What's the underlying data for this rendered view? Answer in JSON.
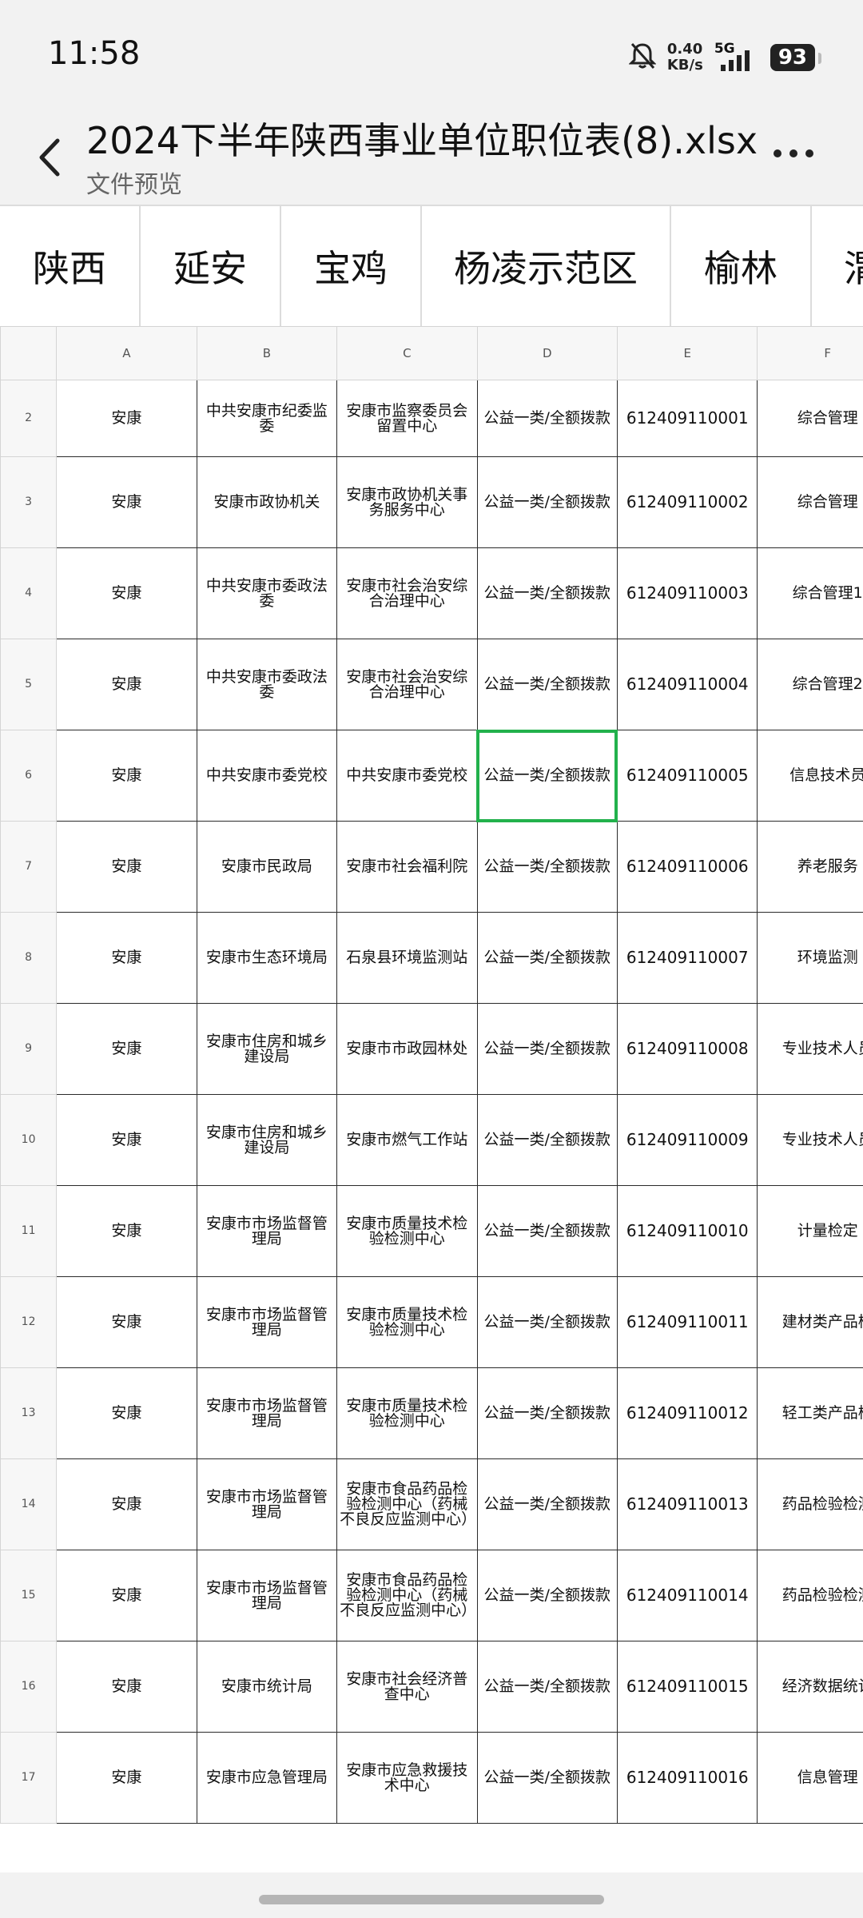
{
  "status": {
    "time": "11:58",
    "net_speed": "0.40",
    "net_unit": "KB/s",
    "network": "5G",
    "battery": "93",
    "icons": [
      "bell-muted-icon",
      "signal-icon",
      "battery-icon"
    ]
  },
  "header": {
    "title": "2024下半年陕西事业单位职位表(8).xlsx",
    "subtitle": "文件预览",
    "back_icon": "chevron-left-icon",
    "more_icon": "more-icon"
  },
  "tabs": [
    "陕西",
    "延安",
    "宝鸡",
    "杨凌示范区",
    "榆林",
    "渭"
  ],
  "columns": [
    "A",
    "B",
    "C",
    "D",
    "E",
    "F"
  ],
  "rows": [
    {
      "n": "2",
      "a": "安康",
      "b": "中共安康市纪委监委",
      "c": "安康市监察委员会留置中心",
      "d": "公益一类/全额拨款",
      "e": "612409110001",
      "f": "综合管理"
    },
    {
      "n": "3",
      "a": "安康",
      "b": "安康市政协机关",
      "c": "安康市政协机关事务服务中心",
      "d": "公益一类/全额拨款",
      "e": "612409110002",
      "f": "综合管理"
    },
    {
      "n": "4",
      "a": "安康",
      "b": "中共安康市委政法委",
      "c": "安康市社会治安综合治理中心",
      "d": "公益一类/全额拨款",
      "e": "612409110003",
      "f": "综合管理1"
    },
    {
      "n": "5",
      "a": "安康",
      "b": "中共安康市委政法委",
      "c": "安康市社会治安综合治理中心",
      "d": "公益一类/全额拨款",
      "e": "612409110004",
      "f": "综合管理2"
    },
    {
      "n": "6",
      "a": "安康",
      "b": "中共安康市委党校",
      "c": "中共安康市委党校",
      "d": "公益一类/全额拨款",
      "e": "612409110005",
      "f": "信息技术员"
    },
    {
      "n": "7",
      "a": "安康",
      "b": "安康市民政局",
      "c": "安康市社会福利院",
      "d": "公益一类/全额拨款",
      "e": "612409110006",
      "f": "养老服务"
    },
    {
      "n": "8",
      "a": "安康",
      "b": "安康市生态环境局",
      "c": "石泉县环境监测站",
      "d": "公益一类/全额拨款",
      "e": "612409110007",
      "f": "环境监测"
    },
    {
      "n": "9",
      "a": "安康",
      "b": "安康市住房和城乡建设局",
      "c": "安康市市政园林处",
      "d": "公益一类/全额拨款",
      "e": "612409110008",
      "f": "专业技术人员"
    },
    {
      "n": "10",
      "a": "安康",
      "b": "安康市住房和城乡建设局",
      "c": "安康市燃气工作站",
      "d": "公益一类/全额拨款",
      "e": "612409110009",
      "f": "专业技术人员"
    },
    {
      "n": "11",
      "a": "安康",
      "b": "安康市市场监督管理局",
      "c": "安康市质量技术检验检测中心",
      "d": "公益一类/全额拨款",
      "e": "612409110010",
      "f": "计量检定"
    },
    {
      "n": "12",
      "a": "安康",
      "b": "安康市市场监督管理局",
      "c": "安康市质量技术检验检测中心",
      "d": "公益一类/全额拨款",
      "e": "612409110011",
      "f": "建材类产品检"
    },
    {
      "n": "13",
      "a": "安康",
      "b": "安康市市场监督管理局",
      "c": "安康市质量技术检验检测中心",
      "d": "公益一类/全额拨款",
      "e": "612409110012",
      "f": "轻工类产品检"
    },
    {
      "n": "14",
      "a": "安康",
      "b": "安康市市场监督管理局",
      "c": "安康市食品药品检验检测中心（药械不良反应监测中心）",
      "d": "公益一类/全额拨款",
      "e": "612409110013",
      "f": "药品检验检测"
    },
    {
      "n": "15",
      "a": "安康",
      "b": "安康市市场监督管理局",
      "c": "安康市食品药品检验检测中心（药械不良反应监测中心）",
      "d": "公益一类/全额拨款",
      "e": "612409110014",
      "f": "药品检验检测"
    },
    {
      "n": "16",
      "a": "安康",
      "b": "安康市统计局",
      "c": "安康市社会经济普查中心",
      "d": "公益一类/全额拨款",
      "e": "612409110015",
      "f": "经济数据统计"
    },
    {
      "n": "17",
      "a": "安康",
      "b": "安康市应急管理局",
      "c": "安康市应急救援技术中心",
      "d": "公益一类/全额拨款",
      "e": "612409110016",
      "f": "信息管理"
    }
  ],
  "selected_cell": "D6"
}
